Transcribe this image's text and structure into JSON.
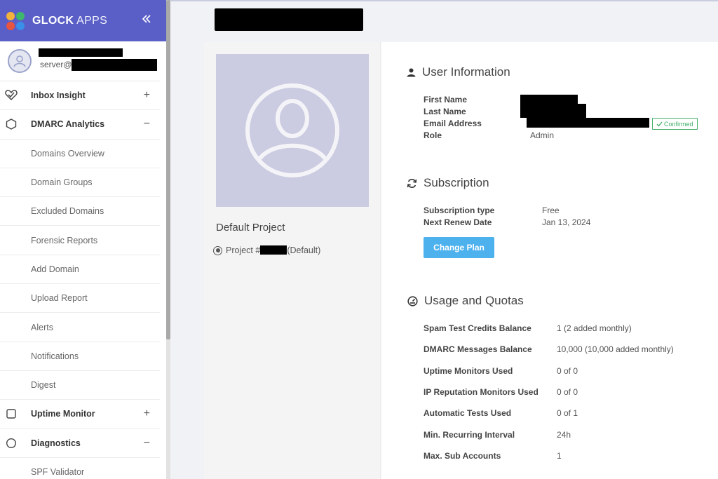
{
  "sidebar": {
    "brand_bold": "GLOCK",
    "brand_light": "APPS",
    "collapse_icon": "double-chevron-left-icon",
    "profile": {
      "email_prefix": "server@"
    },
    "items": [
      {
        "label": "Inbox Insight",
        "type": "parent",
        "icon": "heart-check-icon",
        "toggle": "+"
      },
      {
        "label": "DMARC Analytics",
        "type": "parent",
        "icon": "hexagon-icon",
        "toggle": "−"
      },
      {
        "label": "Domains Overview",
        "type": "child"
      },
      {
        "label": "Domain Groups",
        "type": "child"
      },
      {
        "label": "Excluded Domains",
        "type": "child"
      },
      {
        "label": "Forensic Reports",
        "type": "child"
      },
      {
        "label": "Add Domain",
        "type": "child"
      },
      {
        "label": "Upload Report",
        "type": "child"
      },
      {
        "label": "Alerts",
        "type": "child"
      },
      {
        "label": "Notifications",
        "type": "child"
      },
      {
        "label": "Digest",
        "type": "child"
      },
      {
        "label": "Uptime Monitor",
        "type": "parent",
        "icon": "square-icon",
        "toggle": "+"
      },
      {
        "label": "Diagnostics",
        "type": "parent",
        "icon": "circle-icon",
        "toggle": "−"
      },
      {
        "label": "SPF Validator",
        "type": "child"
      }
    ]
  },
  "project": {
    "name": "Default Project",
    "radio_prefix": "Project #",
    "radio_suffix": "(Default)"
  },
  "user_info": {
    "title": "User Information",
    "labels": {
      "first_name": "First Name",
      "last_name": "Last Name",
      "email": "Email Address",
      "role": "Role"
    },
    "role": "Admin",
    "email_status": "Confirmed"
  },
  "subscription": {
    "title": "Subscription",
    "type_label": "Subscription type",
    "type_value": "Free",
    "renew_label": "Next Renew Date",
    "renew_value": "Jan 13, 2024",
    "change_plan": "Change Plan"
  },
  "usage": {
    "title": "Usage and Quotas",
    "rows": [
      {
        "label": "Spam Test Credits Balance",
        "value": "1 (2 added monthly)"
      },
      {
        "label": "DMARC Messages Balance",
        "value": "10,000 (10,000 added monthly)"
      },
      {
        "label": "Uptime Monitors Used",
        "value": "0 of 0"
      },
      {
        "label": "IP Reputation Monitors Used",
        "value": "0 of 0"
      },
      {
        "label": "Automatic Tests Used",
        "value": "0 of 1"
      },
      {
        "label": "Min. Recurring Interval",
        "value": "24h"
      },
      {
        "label": "Max. Sub Accounts",
        "value": "1"
      }
    ]
  },
  "colors": {
    "header": "#5a5fc7",
    "button": "#4db1ee",
    "confirmed": "#3fae67"
  }
}
